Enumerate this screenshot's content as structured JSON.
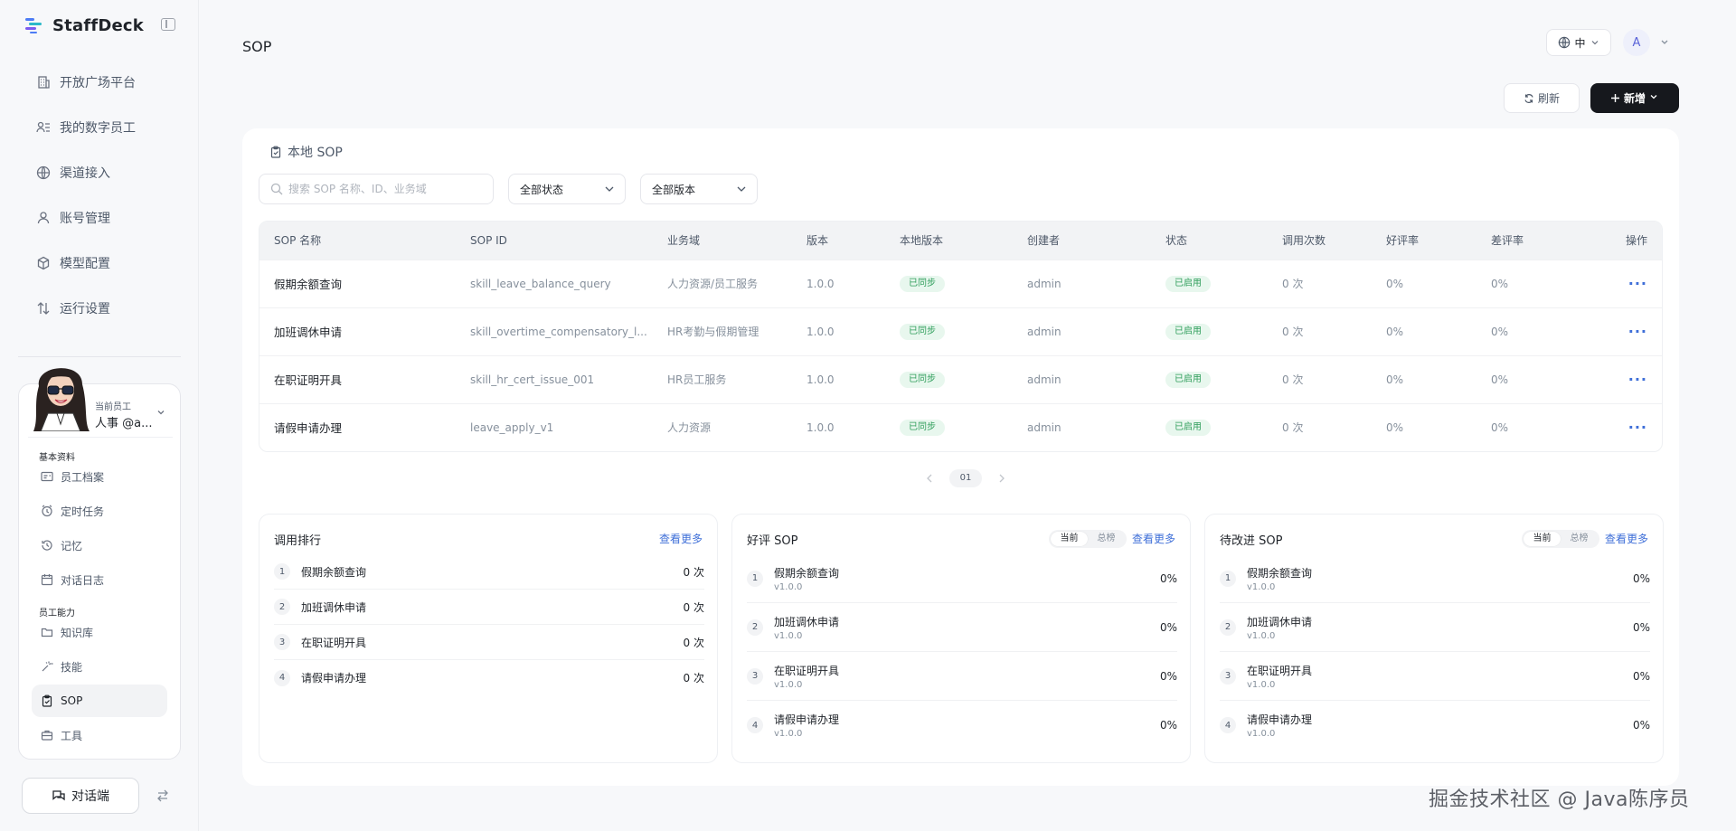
{
  "brand": {
    "name": "StaffDeck"
  },
  "nav": [
    {
      "label": "开放广场平台",
      "icon": "building-icon"
    },
    {
      "label": "我的数字员工",
      "icon": "users-icon"
    },
    {
      "label": "渠道接入",
      "icon": "globe-icon"
    },
    {
      "label": "账号管理",
      "icon": "user-icon"
    },
    {
      "label": "模型配置",
      "icon": "cube-icon"
    },
    {
      "label": "运行设置",
      "icon": "sort-icon"
    }
  ],
  "employee": {
    "caption": "当前员工",
    "name": "人事 @a...",
    "group1": "基本资料",
    "group2": "员工能力",
    "items": [
      {
        "label": "员工档案",
        "icon": "id-card-icon"
      },
      {
        "label": "定时任务",
        "icon": "alarm-icon"
      },
      {
        "label": "记忆",
        "icon": "history-icon"
      },
      {
        "label": "对话日志",
        "icon": "calendar-icon"
      },
      {
        "label": "知识库",
        "icon": "folder-icon"
      },
      {
        "label": "技能",
        "icon": "wand-icon"
      },
      {
        "label": "SOP",
        "icon": "clipboard-icon"
      },
      {
        "label": "工具",
        "icon": "briefcase-icon"
      }
    ],
    "active": "SOP"
  },
  "chat_button": "对话端",
  "header": {
    "title": "SOP",
    "lang": "中",
    "avatar": "A",
    "refresh": "刷新",
    "add": "新增"
  },
  "card": {
    "title": "本地 SOP",
    "search_placeholder": "搜索 SOP 名称、ID、业务域",
    "status_filter": "全部状态",
    "version_filter": "全部版本"
  },
  "table": {
    "columns": [
      "SOP 名称",
      "SOP ID",
      "业务域",
      "版本",
      "本地版本",
      "创建者",
      "状态",
      "调用次数",
      "好评率",
      "差评率",
      "操作"
    ],
    "rows": [
      {
        "name": "假期余额查询",
        "id": "skill_leave_balance_query",
        "domain": "人力资源/员工服务",
        "version": "1.0.0",
        "local": "已同步",
        "creator": "admin",
        "status": "已启用",
        "calls": "0 次",
        "good": "0%",
        "bad": "0%"
      },
      {
        "name": "加班调休申请",
        "id": "skill_overtime_compensatory_l...",
        "domain": "HR考勤与假期管理",
        "version": "1.0.0",
        "local": "已同步",
        "creator": "admin",
        "status": "已启用",
        "calls": "0 次",
        "good": "0%",
        "bad": "0%"
      },
      {
        "name": "在职证明开具",
        "id": "skill_hr_cert_issue_001",
        "domain": "HR员工服务",
        "version": "1.0.0",
        "local": "已同步",
        "creator": "admin",
        "status": "已启用",
        "calls": "0 次",
        "good": "0%",
        "bad": "0%"
      },
      {
        "name": "请假申请办理",
        "id": "leave_apply_v1",
        "domain": "人力资源",
        "version": "1.0.0",
        "local": "已同步",
        "creator": "admin",
        "status": "已启用",
        "calls": "0 次",
        "good": "0%",
        "bad": "0%"
      }
    ],
    "page": "01"
  },
  "panels": {
    "see_more": "查看更多",
    "seg_current": "当前",
    "seg_total": "总榜",
    "ranking": {
      "title": "调用排行",
      "items": [
        {
          "rank": "1",
          "name": "假期余额查询",
          "value": "0 次"
        },
        {
          "rank": "2",
          "name": "加班调休申请",
          "value": "0 次"
        },
        {
          "rank": "3",
          "name": "在职证明开具",
          "value": "0 次"
        },
        {
          "rank": "4",
          "name": "请假申请办理",
          "value": "0 次"
        }
      ]
    },
    "good": {
      "title": "好评 SOP",
      "items": [
        {
          "rank": "1",
          "name": "假期余额查询",
          "version": "v1.0.0",
          "value": "0%"
        },
        {
          "rank": "2",
          "name": "加班调休申请",
          "version": "v1.0.0",
          "value": "0%"
        },
        {
          "rank": "3",
          "name": "在职证明开具",
          "version": "v1.0.0",
          "value": "0%"
        },
        {
          "rank": "4",
          "name": "请假申请办理",
          "version": "v1.0.0",
          "value": "0%"
        }
      ]
    },
    "improve": {
      "title": "待改进 SOP",
      "items": [
        {
          "rank": "1",
          "name": "假期余额查询",
          "version": "v1.0.0",
          "value": "0%"
        },
        {
          "rank": "2",
          "name": "加班调休申请",
          "version": "v1.0.0",
          "value": "0%"
        },
        {
          "rank": "3",
          "name": "在职证明开具",
          "version": "v1.0.0",
          "value": "0%"
        },
        {
          "rank": "4",
          "name": "请假申请办理",
          "version": "v1.0.0",
          "value": "0%"
        }
      ]
    }
  },
  "watermark": "掘金技术社区 @ Java陈序员",
  "colors": {
    "accent": "#3f6fd8",
    "primary_button": "#16181d",
    "success_bg": "#e8f7ee",
    "success_text": "#2f9e5b"
  }
}
